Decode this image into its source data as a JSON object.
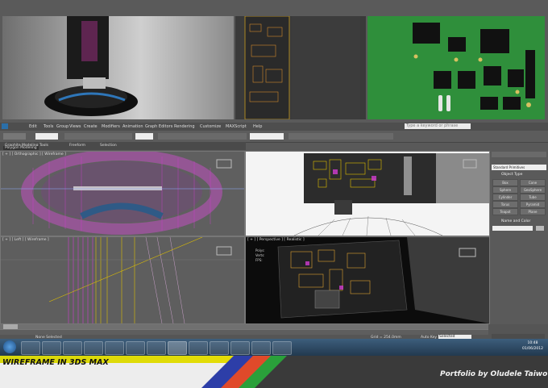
{
  "caption": "WIREFRAME IN 3DS MAX",
  "credit": "Portfolio by Oludele Taiwo",
  "max": {
    "search_placeholder": "Type a keyword or phrase",
    "menu": [
      "Edit",
      "Tools",
      "Group",
      "Views",
      "Create",
      "Modifiers",
      "Animation",
      "Graph Editors",
      "Rendering",
      "Customize",
      "MAXScript",
      "Help"
    ],
    "ribbon_tabs": [
      "Graphite Modeling Tools",
      "Freeform",
      "Selection"
    ],
    "ribbon_sub": "Polygon Modeling",
    "viewports": {
      "top_left": "[ + ] [ Orthographic ] [ Wireframe ]",
      "top_right": "",
      "bottom_left": "[ + ] [ Left ] [ Wireframe ]",
      "bottom_right": "[ + ] [ Perspective ] [ Realistic ]"
    },
    "stats": [
      "Polys:",
      "Verts:",
      "FPS:"
    ],
    "command_panel": {
      "dropdown": "Standard Primitives",
      "section_object_type": "Object Type",
      "buttons": [
        "Box",
        "Cone",
        "Sphere",
        "GeoSphere",
        "Cylinder",
        "Tube",
        "Torus",
        "Pyramid",
        "Teapot",
        "Plane"
      ],
      "section_name_color": "Name and Color"
    },
    "status": {
      "selection": "None Selected",
      "rendering_time": "Rendering Time 0:00:04",
      "grid": "Grid = 254.0mm",
      "auto_key": "Auto Key",
      "set_key": "Set Key",
      "key_filters": "Key Filters...",
      "selected": "Selected",
      "add_time_tag": "Add Time Tag"
    }
  },
  "taskbar": {
    "time": "10:48",
    "date": "01/06/2012"
  },
  "colors": {
    "pcb_green": "#2f8f3b",
    "footer_yellow": "#f4e300",
    "wire_magenta": "#d23cd2",
    "wire_yellow": "#e0c000"
  }
}
